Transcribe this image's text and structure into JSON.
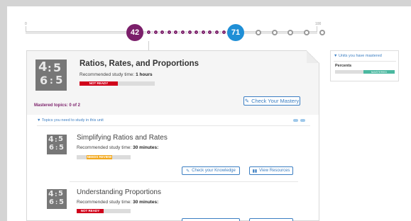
{
  "progress": {
    "start_label": "0",
    "end_label": "100",
    "current_value": "42",
    "target_value": "71",
    "current_color": "#7b1f6a",
    "target_color": "#1f8fd6"
  },
  "unit": {
    "title": "Ratios, Rates, and Proportions",
    "study_prefix": "Recommended study time:",
    "study_time": "1 hours",
    "status": "NOT READY",
    "status_color": "#d0021b",
    "mastered_topics": "Mastered topics: 0 of 2",
    "check_mastery_label": "Check Your Mastery",
    "topics_toggle_label": "Topics you need to study in this unit",
    "icon_glyph": "4:5"
  },
  "topics": [
    {
      "title": "Simplifying Ratios and Rates",
      "study_prefix": "Recommended study time:",
      "study_time": "30 minutes:",
      "status": "NEEDS REVIEW",
      "status_color": "#f2a81d",
      "check_label": "Check your Knowledge",
      "resources_label": "View Resources"
    },
    {
      "title": "Understanding Proportions",
      "study_prefix": "Recommended study time:",
      "study_time": "30 minutes:",
      "status": "NOT READY",
      "status_color": "#d0021b"
    }
  ],
  "sidebar": {
    "header": "Units you have mastered",
    "items": [
      {
        "label": "Percents",
        "status": "MASTERED",
        "status_color": "#4bb8a0"
      }
    ]
  }
}
